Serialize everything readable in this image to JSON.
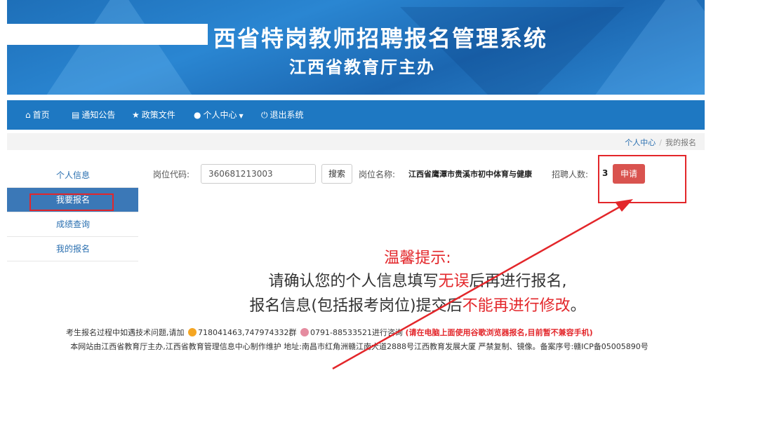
{
  "banner": {
    "title": "西省特岗教师招聘报名管理系统",
    "subtitle": "江西省教育厅主办"
  },
  "nav": {
    "items": [
      {
        "icon": "home-icon",
        "label": "首页"
      },
      {
        "icon": "notice-icon",
        "label": "通知公告"
      },
      {
        "icon": "star-icon",
        "label": "政策文件"
      },
      {
        "icon": "user-icon",
        "label": "个人中心"
      },
      {
        "icon": "power-icon",
        "label": "退出系统"
      }
    ]
  },
  "breadcrumb": {
    "parent": "个人中心",
    "separator": "/",
    "current": "我的报名"
  },
  "sidebar": {
    "items": [
      {
        "label": "个人信息",
        "active": false
      },
      {
        "label": "我要报名",
        "active": true
      },
      {
        "label": "成绩查询",
        "active": false
      },
      {
        "label": "我的报名",
        "active": false
      }
    ]
  },
  "search": {
    "code_label": "岗位代码:",
    "code_value": "360681213003",
    "search_button": "搜索",
    "name_label": "岗位名称:",
    "name_value": "江西省鹰潭市贵溪市初中体育与健康",
    "count_label": "招聘人数:",
    "count_value": "3",
    "apply_button": "申请"
  },
  "tip": {
    "title": "温馨提示:",
    "line1_a": "请确认您的个人信息填写",
    "line1_red": "无误",
    "line1_b": "后再进行报名,",
    "line2_a": "报名信息(包括报考岗位)提交后",
    "line2_red": "不能再进行修改",
    "line2_b": "。"
  },
  "footer": {
    "line1_a": "考生报名过程中如遇技术问题,请加",
    "qq": "718041463,747974332群",
    "phone": "0791-88533521进行咨询",
    "notice": "(请在电脑上面使用谷歌浏览器报名,目前暂不兼容手机)",
    "line2": "本网站由江西省教育厅主办,江西省教育管理信息中心制作维护 地址:南昌市红角洲赣江南大道2888号江西教育发展大厦 严禁复制、镜像。备案序号:赣ICP备05005890号"
  },
  "colors": {
    "nav_bg": "#1e78c2",
    "sidebar_active": "#3b78b7",
    "apply_button": "#d9534f",
    "annotation_red": "#e3262a"
  }
}
